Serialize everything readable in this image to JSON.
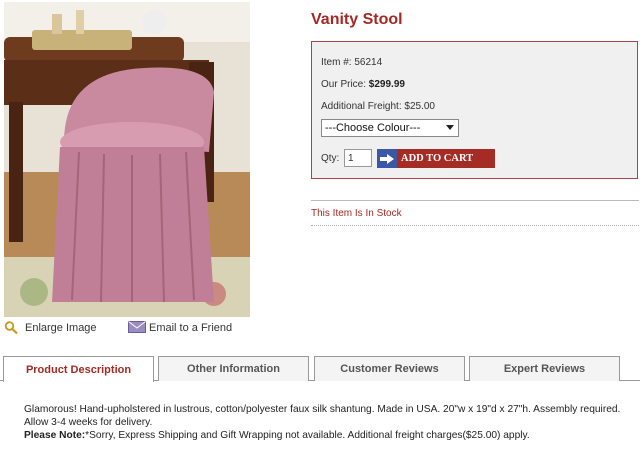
{
  "product": {
    "title": "Vanity Stool",
    "item_label": "Item #:",
    "item_number": "56214",
    "price_label": "Our Price:",
    "price": "$299.99",
    "freight_label": "Additional Freight:",
    "freight": "$25.00",
    "colour_select": "---Choose Colour---",
    "qty_label": "Qty:",
    "qty_value": "1",
    "add_to_cart": "ADD TO CART",
    "stock_status": "This Item Is In Stock"
  },
  "image_links": {
    "enlarge": "Enlarge Image",
    "email": "Email to a Friend"
  },
  "tabs": [
    {
      "label": "Product Description",
      "active": true
    },
    {
      "label": "Other Information",
      "active": false
    },
    {
      "label": "Customer Reviews",
      "active": false
    },
    {
      "label": "Expert Reviews",
      "active": false
    }
  ],
  "description": {
    "text": "Glamorous! Hand-upholstered in lustrous, cotton/polyester faux silk shantung. Made in USA. 20\"w x 19\"d x 27\"h. Assembly required. Allow 3-4 weeks for delivery.",
    "note_label": "Please Note:",
    "note_text": "*Sorry, Express Shipping and Gift Wrapping not available. Additional freight charges($25.00) apply."
  },
  "colors": {
    "brand_red": "#a32a24",
    "cart_blue": "#3a58a5",
    "stool_pink": "#c98aa0"
  }
}
